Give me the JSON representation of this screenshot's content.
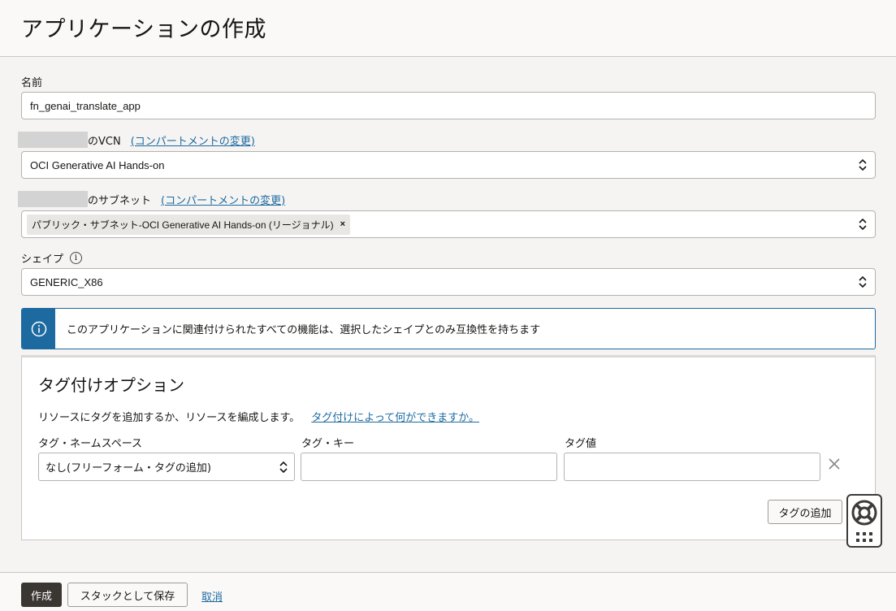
{
  "page_title": "アプリケーションの作成",
  "name": {
    "label": "名前",
    "value": "fn_genai_translate_app"
  },
  "vcn": {
    "label": "のVCN",
    "change_link": "(コンパートメントの変更)",
    "value": "OCI Generative AI Hands-on"
  },
  "subnet": {
    "label": "のサブネット",
    "change_link": "(コンパートメントの変更)",
    "chip": "パブリック・サブネット-OCI Generative AI Hands-on (リージョナル)",
    "chip_remove": "×"
  },
  "shape": {
    "label": "シェイプ",
    "info_icon": "i",
    "value": "GENERIC_X86"
  },
  "banner": {
    "message": "このアプリケーションに関連付けられたすべての機能は、選択したシェイプとのみ互換性を持ちます"
  },
  "tagging": {
    "title": "タグ付けオプション",
    "description": "リソースにタグを追加するか、リソースを編成します。",
    "help_link": "タグ付けによって何ができますか。",
    "namespace_header": "タグ・ネームスペース",
    "key_header": "タグ・キー",
    "value_header": "タグ値",
    "namespace_value": "なし(フリーフォーム・タグの追加)",
    "key_value": "",
    "value_value": "",
    "add_tag_button": "タグの追加"
  },
  "footer": {
    "create_button": "作成",
    "save_stack_button": "スタックとして保存",
    "cancel_link": "取消"
  },
  "colors": {
    "accent_blue": "#1c6aa0",
    "primary_button": "#3a3632",
    "background": "#f5f4f2"
  }
}
